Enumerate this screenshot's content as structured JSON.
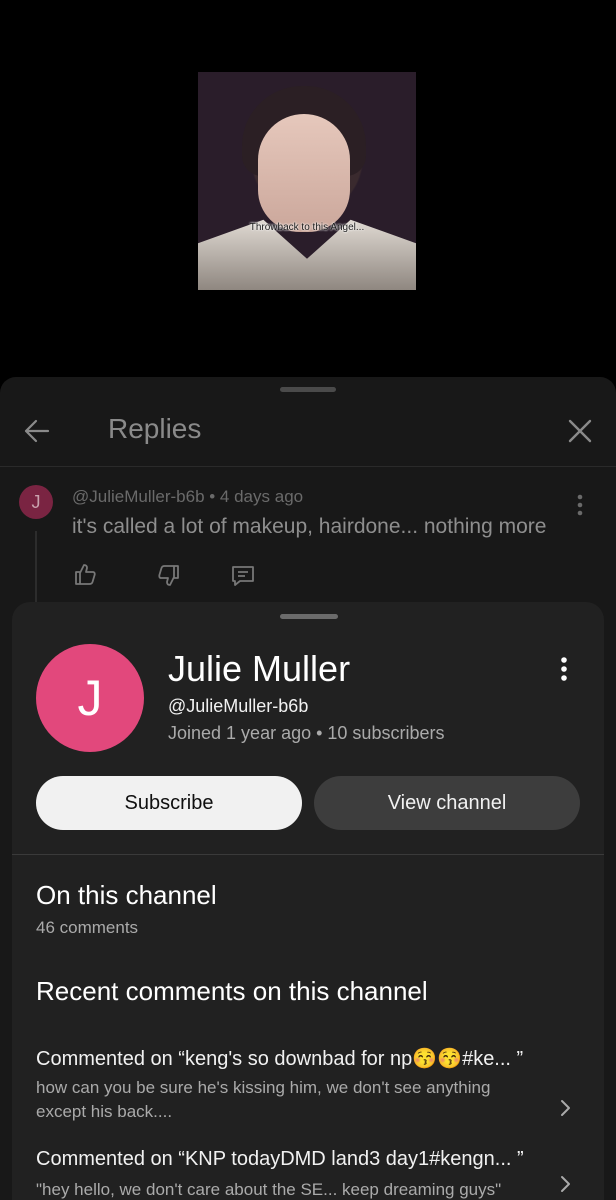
{
  "video": {
    "caption": "Throwback to this Angel..."
  },
  "replies": {
    "title": "Replies",
    "comment": {
      "avatar_letter": "J",
      "meta": "@JulieMuller-b6b • 4 days ago",
      "text": "it's called a lot of makeup, hairdone... nothing more"
    }
  },
  "profile": {
    "avatar_letter": "J",
    "avatar_color": "#e2487c",
    "name": "Julie Muller",
    "handle": "@JulieMuller-b6b",
    "stats": "Joined 1 year ago • 10 subscribers",
    "subscribe_label": "Subscribe",
    "view_channel_label": "View channel"
  },
  "on_channel": {
    "title": "On this channel",
    "count": "46 comments"
  },
  "recent": {
    "title": "Recent comments on this channel",
    "items": [
      {
        "head": "Commented on “keng's so downbad for np😚😚#ke...  ”",
        "body": "how can you be sure he's kissing him, we don't see anything except his back...."
      },
      {
        "head": "Commented on “KNP todayDMD land3 day1#kengn...  ”",
        "body": "\"hey hello, we don't care about the SE... keep dreaming guys\""
      }
    ]
  }
}
